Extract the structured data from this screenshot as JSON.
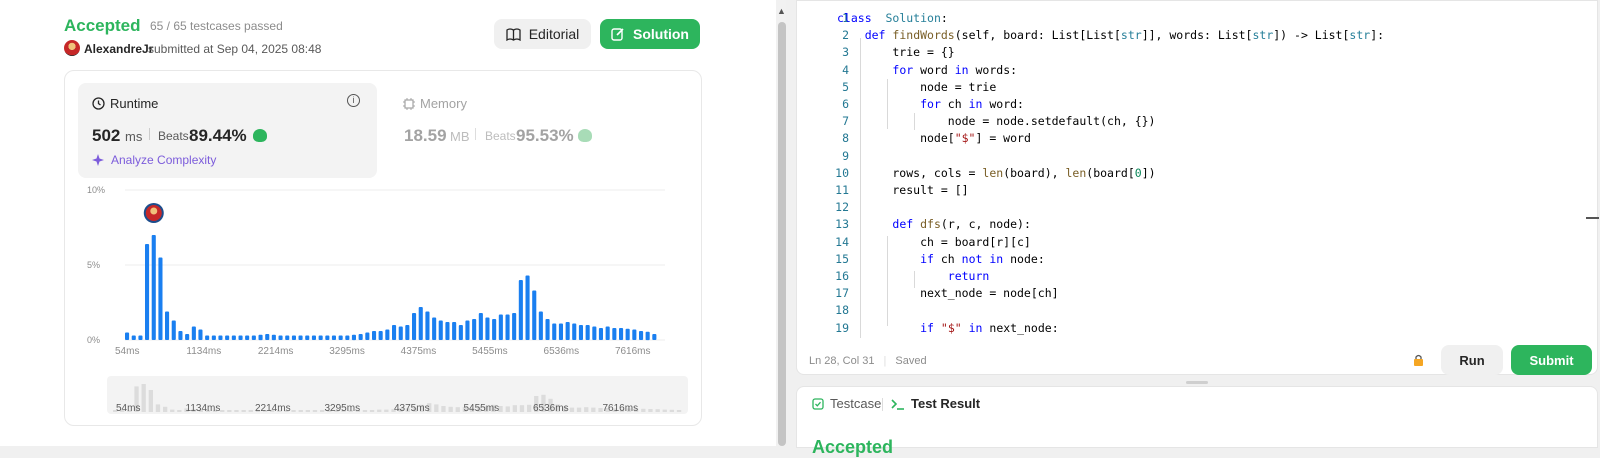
{
  "submission": {
    "status": "Accepted",
    "testcases": "65 / 65 testcases passed",
    "author": "AlexandreJr",
    "submitted_at": "submitted at Sep 04, 2025 08:48"
  },
  "actions": {
    "editorial_label": "Editorial",
    "solution_label": "Solution"
  },
  "runtime": {
    "label": "Runtime",
    "value": "502",
    "unit": "ms",
    "beats_label": "Beats",
    "beats": "89.44%",
    "analyze_label": "Analyze Complexity"
  },
  "memory": {
    "label": "Memory",
    "value": "18.59",
    "unit": "MB",
    "beats_label": "Beats",
    "beats": "95.53%"
  },
  "chart_data": {
    "type": "bar",
    "ylim": [
      0,
      10
    ],
    "y_ticks": [
      "10%",
      "5%",
      "0%"
    ],
    "x_ticks": [
      "54ms",
      "1134ms",
      "2214ms",
      "3295ms",
      "4375ms",
      "5455ms",
      "6536ms",
      "7616ms"
    ],
    "values": [
      0.5,
      0.3,
      0.3,
      6.4,
      7.0,
      5.5,
      1.9,
      1.3,
      0.6,
      0.4,
      0.9,
      0.7,
      0.3,
      0.3,
      0.3,
      0.3,
      0.3,
      0.3,
      0.3,
      0.3,
      0.35,
      0.4,
      0.35,
      0.3,
      0.3,
      0.3,
      0.3,
      0.3,
      0.3,
      0.3,
      0.3,
      0.3,
      0.3,
      0.3,
      0.35,
      0.4,
      0.5,
      0.6,
      0.6,
      0.7,
      1.0,
      0.9,
      1.0,
      1.8,
      2.2,
      1.9,
      1.5,
      1.3,
      1.2,
      1.2,
      1.0,
      1.3,
      1.4,
      1.8,
      1.5,
      1.4,
      1.7,
      1.7,
      1.8,
      4.0,
      4.3,
      3.3,
      1.9,
      1.4,
      1.1,
      1.1,
      1.2,
      1.1,
      1.0,
      1.0,
      0.9,
      0.8,
      0.9,
      0.8,
      0.8,
      0.75,
      0.7,
      0.6,
      0.55,
      0.4
    ],
    "highlight_index": 4,
    "bar_color": "#1a7ff0"
  },
  "code": {
    "lines": [
      [
        [
          "kw",
          "class"
        ],
        [
          "",
          "  "
        ],
        [
          "ty",
          "Solution"
        ],
        [
          "",
          ":"
        ]
      ],
      [
        [
          "",
          "    "
        ],
        [
          "kw",
          "def"
        ],
        [
          "",
          " "
        ],
        [
          "fn",
          "findWords"
        ],
        [
          "",
          "(self, board: List[List["
        ],
        [
          "ty",
          "str"
        ],
        [
          "",
          "]], words: List["
        ],
        [
          "ty",
          "str"
        ],
        [
          "",
          "]) -> List["
        ],
        [
          "ty",
          "str"
        ],
        [
          "",
          "]:"
        ]
      ],
      [
        [
          "",
          "        trie = {}"
        ]
      ],
      [
        [
          "",
          "        "
        ],
        [
          "kw",
          "for"
        ],
        [
          "",
          " word "
        ],
        [
          "kw",
          "in"
        ],
        [
          "",
          " words:"
        ]
      ],
      [
        [
          "",
          "            node = trie"
        ]
      ],
      [
        [
          "",
          "            "
        ],
        [
          "kw",
          "for"
        ],
        [
          "",
          " ch "
        ],
        [
          "kw",
          "in"
        ],
        [
          "",
          " word:"
        ]
      ],
      [
        [
          "",
          "                node = node.setdefault(ch, {})"
        ]
      ],
      [
        [
          "",
          "            node["
        ],
        [
          "st",
          "\"$\""
        ],
        [
          "",
          "] = word"
        ]
      ],
      [
        [
          "",
          ""
        ]
      ],
      [
        [
          "",
          "        rows, cols = "
        ],
        [
          "fn",
          "len"
        ],
        [
          "",
          "(board), "
        ],
        [
          "fn",
          "len"
        ],
        [
          "",
          "(board["
        ],
        [
          "nm",
          "0"
        ],
        [
          "",
          "])"
        ]
      ],
      [
        [
          "",
          "        result = []"
        ]
      ],
      [
        [
          "",
          ""
        ]
      ],
      [
        [
          "",
          "        "
        ],
        [
          "kw",
          "def"
        ],
        [
          "",
          " "
        ],
        [
          "fn",
          "dfs"
        ],
        [
          "",
          "(r, c, node):"
        ]
      ],
      [
        [
          "",
          "            ch = board[r][c]"
        ]
      ],
      [
        [
          "",
          "            "
        ],
        [
          "kw",
          "if"
        ],
        [
          "",
          " ch "
        ],
        [
          "kw",
          "not in"
        ],
        [
          "",
          " node:"
        ]
      ],
      [
        [
          "",
          "                "
        ],
        [
          "kw",
          "return"
        ]
      ],
      [
        [
          "",
          "            next_node = node[ch]"
        ]
      ],
      [
        [
          "",
          ""
        ]
      ],
      [
        [
          "",
          "            "
        ],
        [
          "kw",
          "if"
        ],
        [
          "",
          " "
        ],
        [
          "st",
          "\"$\""
        ],
        [
          "",
          " "
        ],
        [
          "kw",
          "in"
        ],
        [
          "",
          " next_node:"
        ]
      ]
    ]
  },
  "editor_footer": {
    "cursor": "Ln 28, Col 31",
    "saved": "Saved",
    "run_label": "Run",
    "submit_label": "Submit"
  },
  "bottom_panel": {
    "testcase_tab": "Testcase",
    "result_tab": "Test Result",
    "peek_status": "Accepted"
  }
}
